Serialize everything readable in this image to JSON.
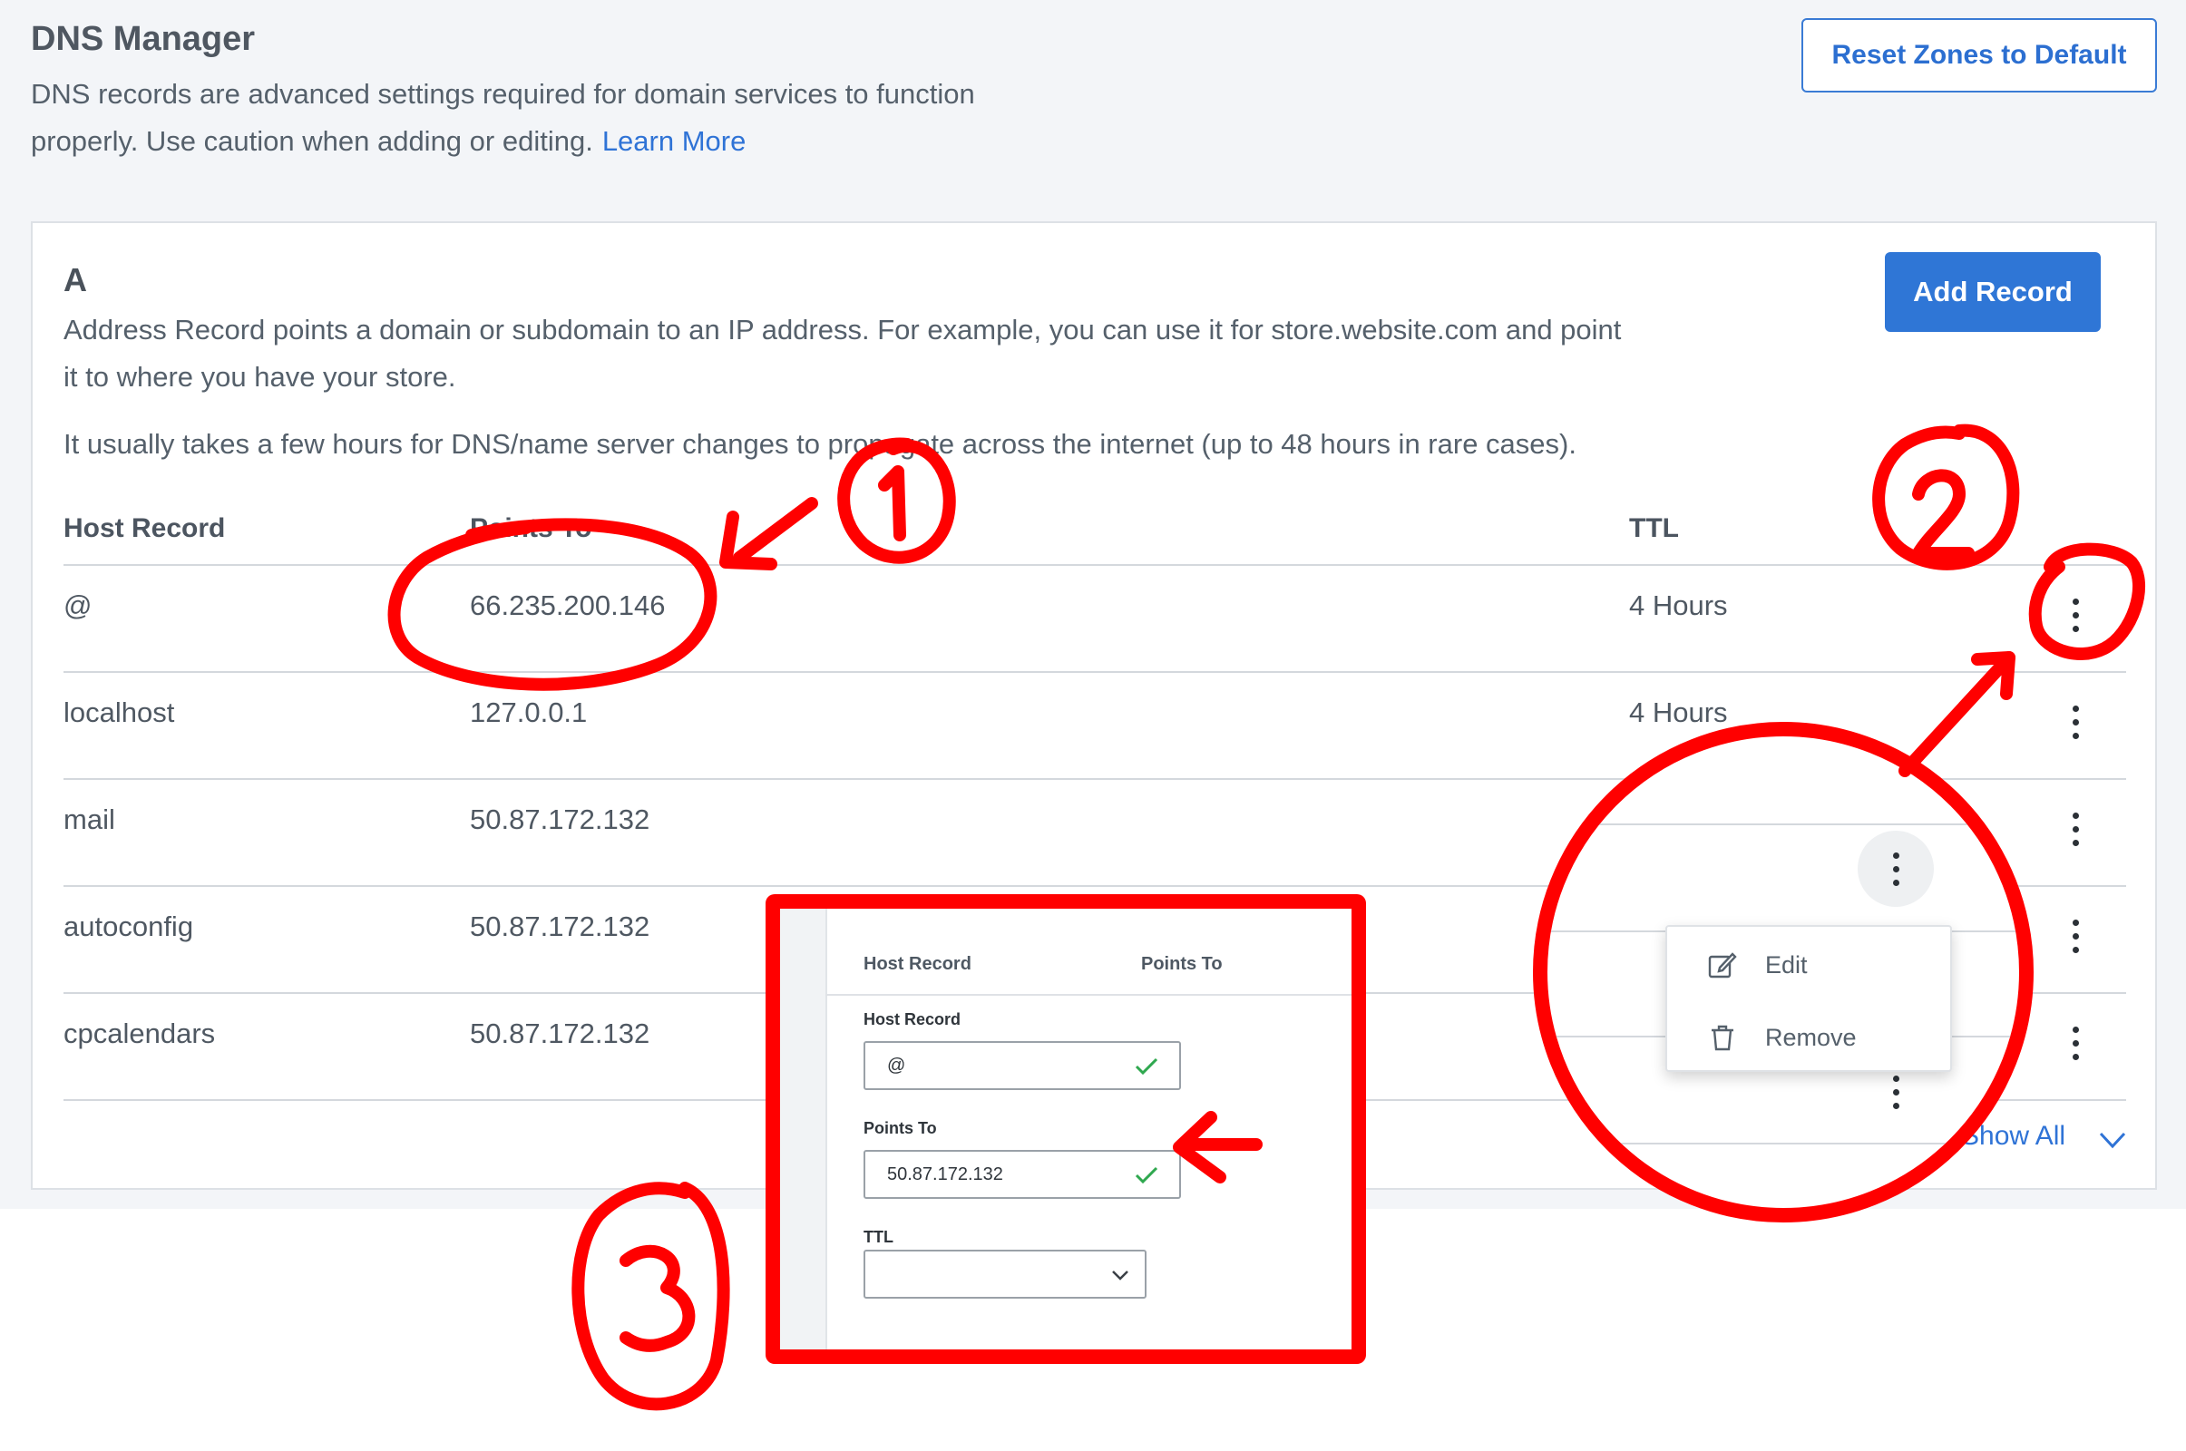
{
  "header": {
    "title": "DNS Manager",
    "description": "DNS records are advanced settings required for domain services to function properly. Use caution when adding or editing.",
    "learn_more": "Learn More",
    "reset_button": "Reset Zones to Default"
  },
  "section": {
    "letter": "A",
    "description": "Address Record points a domain or subdomain to an IP address. For example, you can use it for store.website.com and point it to where you have your store.",
    "note": "It usually takes a few hours for DNS/name server changes to propagate across the internet (up to 48 hours in rare cases).",
    "add_button": "Add Record",
    "columns": {
      "host": "Host Record",
      "points_to": "Points To",
      "ttl": "TTL"
    },
    "rows": [
      {
        "host": "@",
        "points_to": "66.235.200.146",
        "ttl": "4 Hours"
      },
      {
        "host": "localhost",
        "points_to": "127.0.0.1",
        "ttl": "4 Hours"
      },
      {
        "host": "mail",
        "points_to": "50.87.172.132",
        "ttl": ""
      },
      {
        "host": "autoconfig",
        "points_to": "50.87.172.132",
        "ttl": ""
      },
      {
        "host": "cpcalendars",
        "points_to": "50.87.172.132",
        "ttl": ""
      }
    ],
    "show_all": "Show All"
  },
  "inset_form": {
    "col_host": "Host Record",
    "col_points": "Points To",
    "host_label": "Host Record",
    "host_value": "@",
    "points_label": "Points To",
    "points_value": "50.87.172.132",
    "ttl_label": "TTL",
    "ttl_value": ""
  },
  "zoom_menu": {
    "items": [
      {
        "label": "Edit",
        "icon": "edit-icon"
      },
      {
        "label": "Remove",
        "icon": "trash-icon"
      }
    ]
  },
  "annotations": {
    "colors": {
      "red": "#ff0000",
      "link": "#2f73d6",
      "button": "#2f76d6",
      "check": "#2fa84f"
    }
  }
}
